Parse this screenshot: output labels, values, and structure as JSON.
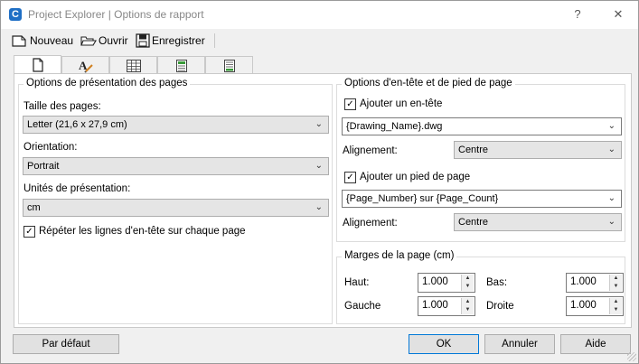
{
  "window": {
    "title": "Project Explorer | Options de rapport",
    "help": "?",
    "close": "✕",
    "app_icon": "C"
  },
  "toolbar": {
    "new_label": "Nouveau",
    "open_label": "Ouvrir",
    "save_label": "Enregistrer"
  },
  "tabs": [
    "page-icon",
    "text-format-icon",
    "table-icon",
    "calculator-icon",
    "spreadsheet-icon"
  ],
  "left": {
    "group_title": "Options de présentation des pages",
    "page_size_label": "Taille des pages:",
    "page_size_value": "Letter (21,6 x 27,9 cm)",
    "orientation_label": "Orientation:",
    "orientation_value": "Portrait",
    "units_label": "Unités de présentation:",
    "units_value": "cm",
    "repeat_label": "Répéter les lignes d'en-tête sur chaque page",
    "repeat_checked": true
  },
  "right": {
    "group_title": "Options d'en-tête et de pied de page",
    "header_check_label": "Ajouter un en-tête",
    "header_value": "{Drawing_Name}.dwg",
    "align_label": "Alignement:",
    "header_align": "Centre",
    "footer_check_label": "Ajouter un pied de page",
    "footer_value": "{Page_Number} sur {Page_Count}",
    "footer_align": "Centre"
  },
  "margins": {
    "group_title": "Marges de la page (cm)",
    "top_label": "Haut:",
    "top_value": "1.000",
    "bottom_label": "Bas:",
    "bottom_value": "1.000",
    "left_label": "Gauche",
    "left_value": "1.000",
    "right_label": "Droite",
    "right_value": "1.000"
  },
  "buttons": {
    "default_label": "Par défaut",
    "ok_label": "OK",
    "cancel_label": "Annuler",
    "help_label": "Aide"
  }
}
